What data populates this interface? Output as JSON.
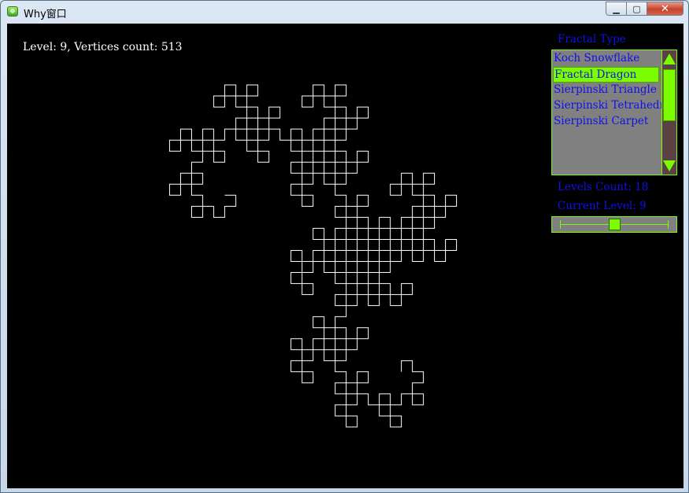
{
  "window": {
    "title": "Why窗口",
    "minimize_label": "▁",
    "maximize_label": "▢",
    "close_label": "✕"
  },
  "scene": {
    "status_text": "Level: 9, Vertices count: 513",
    "line_color": "#ffffff",
    "background": "#000000"
  },
  "panel": {
    "fractal_type_label": "Fractal Type",
    "fractal_types": [
      {
        "label": "Koch Snowflake",
        "selected": false
      },
      {
        "label": "Fractal Dragon",
        "selected": true
      },
      {
        "label": "Sierpinski Triangle",
        "selected": false
      },
      {
        "label": "Sierpinski Tetrahedron",
        "selected": false
      },
      {
        "label": "Sierpinski Carpet",
        "selected": false
      }
    ],
    "levels_count_label": "Levels Count: 18",
    "current_level_label": "Current Level: 9",
    "levels_count": 18,
    "current_level": 9,
    "accent_color": "#7cfc00",
    "text_color": "#1010e8",
    "panel_bg": "#808080"
  }
}
